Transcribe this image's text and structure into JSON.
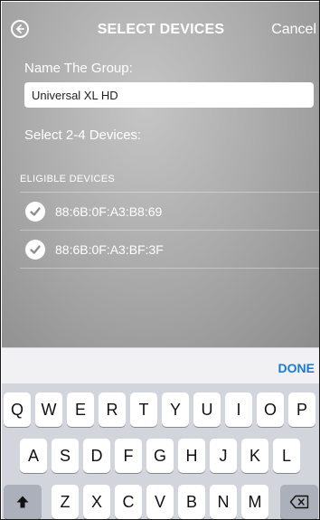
{
  "nav": {
    "back_icon": "circle-arrow-left-icon",
    "title": "SELECT DEVICES",
    "cancel": "Cancel"
  },
  "form": {
    "name_label": "Name The Group:",
    "name_value": "Universal XL HD",
    "select_label": "Select 2-4 Devices:"
  },
  "devices": {
    "header": "ELIGIBLE DEVICES",
    "items": [
      {
        "label": "88:6B:0F:A3:B8:69",
        "checked": true
      },
      {
        "label": "88:6B:0F:A3:BF:3F",
        "checked": true
      }
    ]
  },
  "keyboard": {
    "done": "DONE",
    "row1": [
      "Q",
      "W",
      "E",
      "R",
      "T",
      "Y",
      "U",
      "I",
      "O",
      "P"
    ],
    "row2": [
      "A",
      "S",
      "D",
      "F",
      "G",
      "H",
      "J",
      "K",
      "L"
    ],
    "row3": [
      "Z",
      "X",
      "C",
      "V",
      "B",
      "N",
      "M"
    ],
    "shift_icon": "shift-arrow-icon",
    "backspace_icon": "backspace-icon"
  },
  "colors": {
    "accent": "#1a78d6",
    "keyboard_bg": "#d2d5db"
  }
}
